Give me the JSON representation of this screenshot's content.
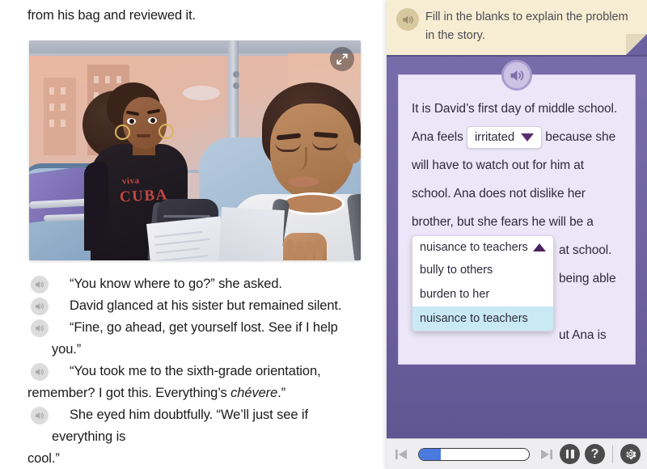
{
  "reader": {
    "top_paragraph": "from his bag and reviewed it.",
    "expand_icon": "expand-arrows-icon",
    "illustration_alt": "Illustration of a girl with a Viva Cuba t-shirt sitting on a bus beside a boy reading a folded paper",
    "illustration_text": {
      "viva": "viva",
      "cuba": "CUBA"
    },
    "dialogue": [
      {
        "speaker_icon": "speaker-icon",
        "text": "“You know where to go?” she asked."
      },
      {
        "speaker_icon": "speaker-icon",
        "text": "David glanced at his sister but remained silent."
      },
      {
        "speaker_icon": "speaker-icon",
        "text": "“Fine, go ahead, get yourself lost. See if I help you.”"
      },
      {
        "speaker_icon": "speaker-icon",
        "text_a": "“You took me to the sixth-grade orientation,",
        "text_b": "remember? I got this. Everything’s ",
        "text_italic": "chévere",
        "text_c": ".”"
      },
      {
        "speaker_icon": "speaker-icon",
        "text_a": "She eyed him doubtfully. “We’ll just see if everything is",
        "text_b": "cool.”"
      }
    ]
  },
  "activity": {
    "instruction": {
      "speaker_icon": "speaker-icon",
      "text": "Fill in the blanks to explain the problem in the story."
    },
    "card": {
      "speaker_icon": "speaker-icon",
      "line1": "It is David’s first day of middle school.",
      "line2_pre": "Ana feels",
      "select1_value": "irritated",
      "select1_caret": "chevron-down-icon",
      "line2_post": "because she",
      "line3": "will have to watch out for him at",
      "line4": "school. Ana does not dislike her",
      "line5": "brother, but she fears he will be a",
      "line6_after_dropdown": "at school.",
      "line7": "being able to",
      "line8": "ut Ana is",
      "dropdown": {
        "current": "nuisance to teachers",
        "caret": "chevron-up-icon",
        "options": [
          {
            "label": "bully to others",
            "selected": false
          },
          {
            "label": "burden to her",
            "selected": false
          },
          {
            "label": "nuisance to teachers",
            "selected": true
          }
        ]
      }
    },
    "toolbar": {
      "prev_icon": "previous-track-icon",
      "next_icon": "next-track-icon",
      "pause_icon": "pause-icon",
      "help_icon": "question-mark-icon",
      "help_label": "?",
      "settings_icon": "gear-icon",
      "progress_percent": 20
    }
  },
  "colors": {
    "panel_purple": "#6e63a0",
    "card_lilac": "#ece7f8",
    "instruction_cream": "#f7edd3",
    "option_highlight": "#c9eaf4",
    "progress_blue": "#4a7ae0",
    "caret_plum": "#5b2d6e"
  }
}
